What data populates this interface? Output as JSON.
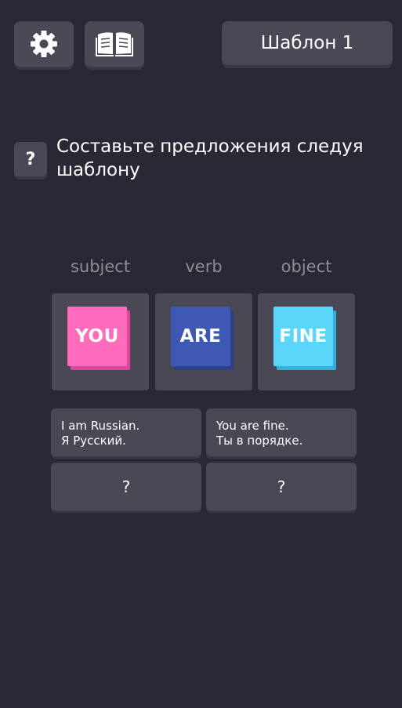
{
  "header": {
    "settings_icon": "gear-icon",
    "book_icon": "open-book-icon",
    "template_label": "Шаблон 1"
  },
  "task": {
    "help_label": "?",
    "instruction": "Составьте предложения следуя шаблону"
  },
  "pattern": {
    "columns": [
      {
        "label": "subject",
        "word": "YOU",
        "color": "#ff6cbc",
        "side": "#e0449e"
      },
      {
        "label": "verb",
        "word": "ARE",
        "color": "#3f58b3",
        "side": "#2e418a"
      },
      {
        "label": "object",
        "word": "FINE",
        "color": "#5ad6fb",
        "side": "#2fb2de"
      }
    ]
  },
  "examples": [
    {
      "line1": "I am Russian.",
      "line2": "Я Русский."
    },
    {
      "line1": "You are fine.",
      "line2": "Ты в порядке."
    }
  ],
  "pending": [
    {
      "label": "?"
    },
    {
      "label": "?"
    }
  ]
}
